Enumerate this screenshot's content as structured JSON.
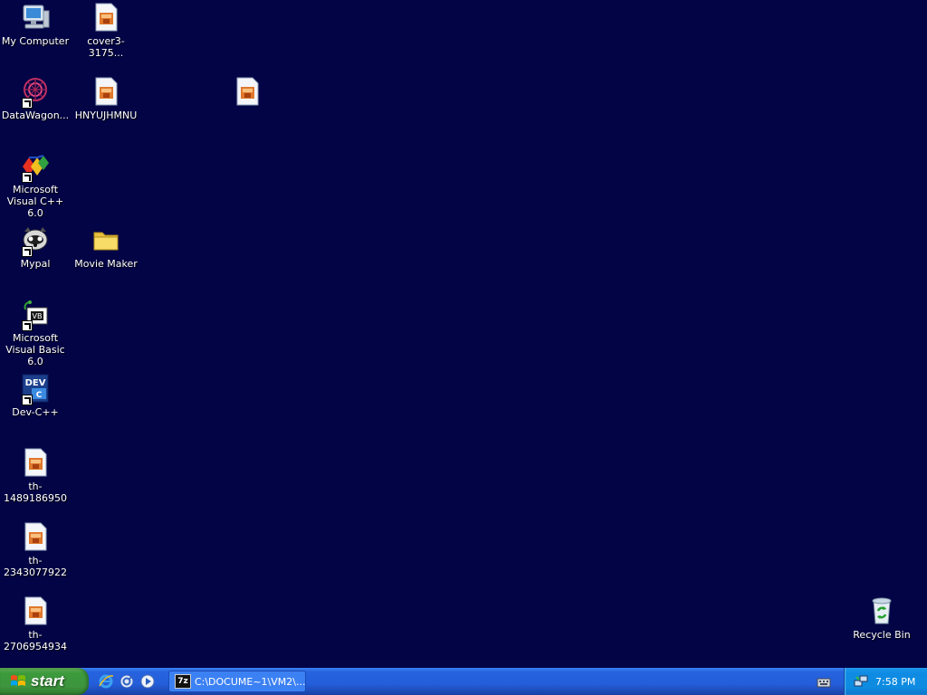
{
  "desktop": {
    "background_color": "#020446",
    "icons": [
      {
        "id": "my-computer",
        "label": "My Computer",
        "icon": "computer-icon"
      },
      {
        "id": "cover3",
        "label": "cover3-3175...",
        "icon": "image-file-icon"
      },
      {
        "id": "datawagon",
        "label": "DataWagon...",
        "icon": "datawagon-icon"
      },
      {
        "id": "hnyujhmnu",
        "label": "HNYUJHMNU",
        "icon": "image-file-icon"
      },
      {
        "id": "untitled-image",
        "label": "",
        "icon": "image-file-icon"
      },
      {
        "id": "visual-cpp",
        "label": "Microsoft Visual C++ 6.0",
        "icon": "visual-cpp-icon"
      },
      {
        "id": "mypal",
        "label": "Mypal",
        "icon": "mypal-icon"
      },
      {
        "id": "movie-maker",
        "label": "Movie Maker",
        "icon": "folder-icon"
      },
      {
        "id": "visual-basic",
        "label": "Microsoft Visual Basic 6.0",
        "icon": "visual-basic-icon"
      },
      {
        "id": "dev-cpp",
        "label": "Dev-C++",
        "icon": "dev-cpp-icon"
      },
      {
        "id": "th-1489",
        "label": "th-1489186950",
        "icon": "image-file-icon"
      },
      {
        "id": "th-2343",
        "label": "th-2343077922",
        "icon": "image-file-icon"
      },
      {
        "id": "th-2706",
        "label": "th-2706954934",
        "icon": "image-file-icon"
      },
      {
        "id": "recycle-bin",
        "label": "Recycle Bin",
        "icon": "recycle-bin-icon"
      }
    ]
  },
  "taskbar": {
    "start_label": "start",
    "quick_launch": [
      {
        "icon": "internet-explorer-icon"
      },
      {
        "icon": "browser-icon"
      },
      {
        "icon": "media-player-icon"
      }
    ],
    "task_button": {
      "icon_text": "7z",
      "label": "C:\\DOCUME~1\\VM2\\..."
    },
    "tray": {
      "clock": "7:58 PM"
    }
  }
}
